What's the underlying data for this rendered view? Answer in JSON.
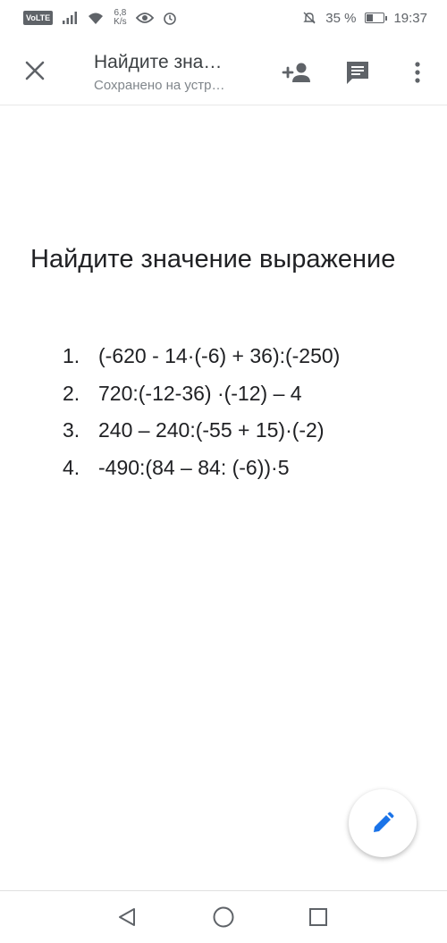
{
  "status_bar": {
    "network_badge": "VoLTE",
    "speed_value": "6,8",
    "speed_unit": "K/s",
    "battery_percent": "35 %",
    "battery_level": 0.35,
    "time": "19:37"
  },
  "app_bar": {
    "title": "Найдите зна…",
    "subtitle": "Сохранено на устр…",
    "icons": [
      "close-icon",
      "add-person-icon",
      "comment-icon",
      "more-vert-icon"
    ]
  },
  "document": {
    "heading": "Найдите значение выражение",
    "tasks": [
      {
        "num": "1.",
        "text": "(-620 - 14·(-6) + 36):(-250)"
      },
      {
        "num": "2.",
        "text": "720:(-12-36) ·(-12) – 4"
      },
      {
        "num": "3.",
        "text": "240 – 240:(-55 + 15)·(-2)"
      },
      {
        "num": "4.",
        "text": "-490:(84 – 84: (-6))·5"
      }
    ]
  },
  "fab": {
    "icon": "edit-pencil-icon",
    "color": "#1a73e8"
  },
  "nav": {
    "icons": [
      "back-triangle-icon",
      "home-circle-icon",
      "recents-square-icon"
    ]
  }
}
